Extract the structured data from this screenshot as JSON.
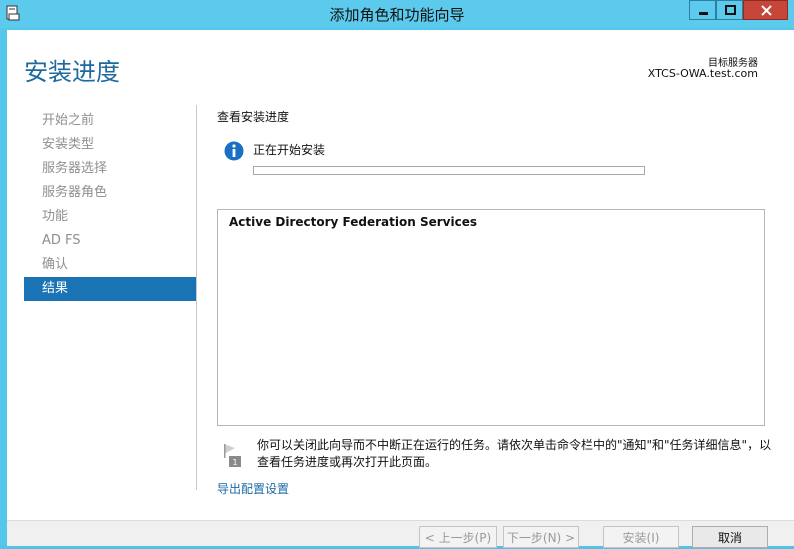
{
  "window": {
    "title": "添加角色和功能向导",
    "accent": "#54c7ec",
    "close_color": "#c7463a",
    "app_icon": "wizard-app-icon"
  },
  "header": {
    "heading": "安装进度",
    "target_label": "目标服务器",
    "target_server": "XTCS-OWA.test.com"
  },
  "nav": {
    "items": [
      {
        "label": "开始之前"
      },
      {
        "label": "安装类型"
      },
      {
        "label": "服务器选择"
      },
      {
        "label": "服务器角色"
      },
      {
        "label": "功能"
      },
      {
        "label": "AD FS"
      },
      {
        "label": "确认"
      },
      {
        "label": "结果"
      }
    ],
    "active_index": 7,
    "active_color": "#1a73b5"
  },
  "main": {
    "section_title": "查看安装进度",
    "status_icon": "info-icon",
    "status_text": "正在开始安装",
    "progress": 0,
    "results": [
      "Active Directory Federation Services"
    ],
    "note_icon": "flag-notification-icon",
    "note_text": "你可以关闭此向导而不中断正在运行的任务。请依次单击命令栏中的\"通知\"和\"任务详细信息\"，以查看任务进度或再次打开此页面。",
    "export_link": "导出配置设置"
  },
  "footer": {
    "prev": "< 上一步(P)",
    "next": "下一步(N) >",
    "install": "安装(I)",
    "cancel": "取消"
  }
}
